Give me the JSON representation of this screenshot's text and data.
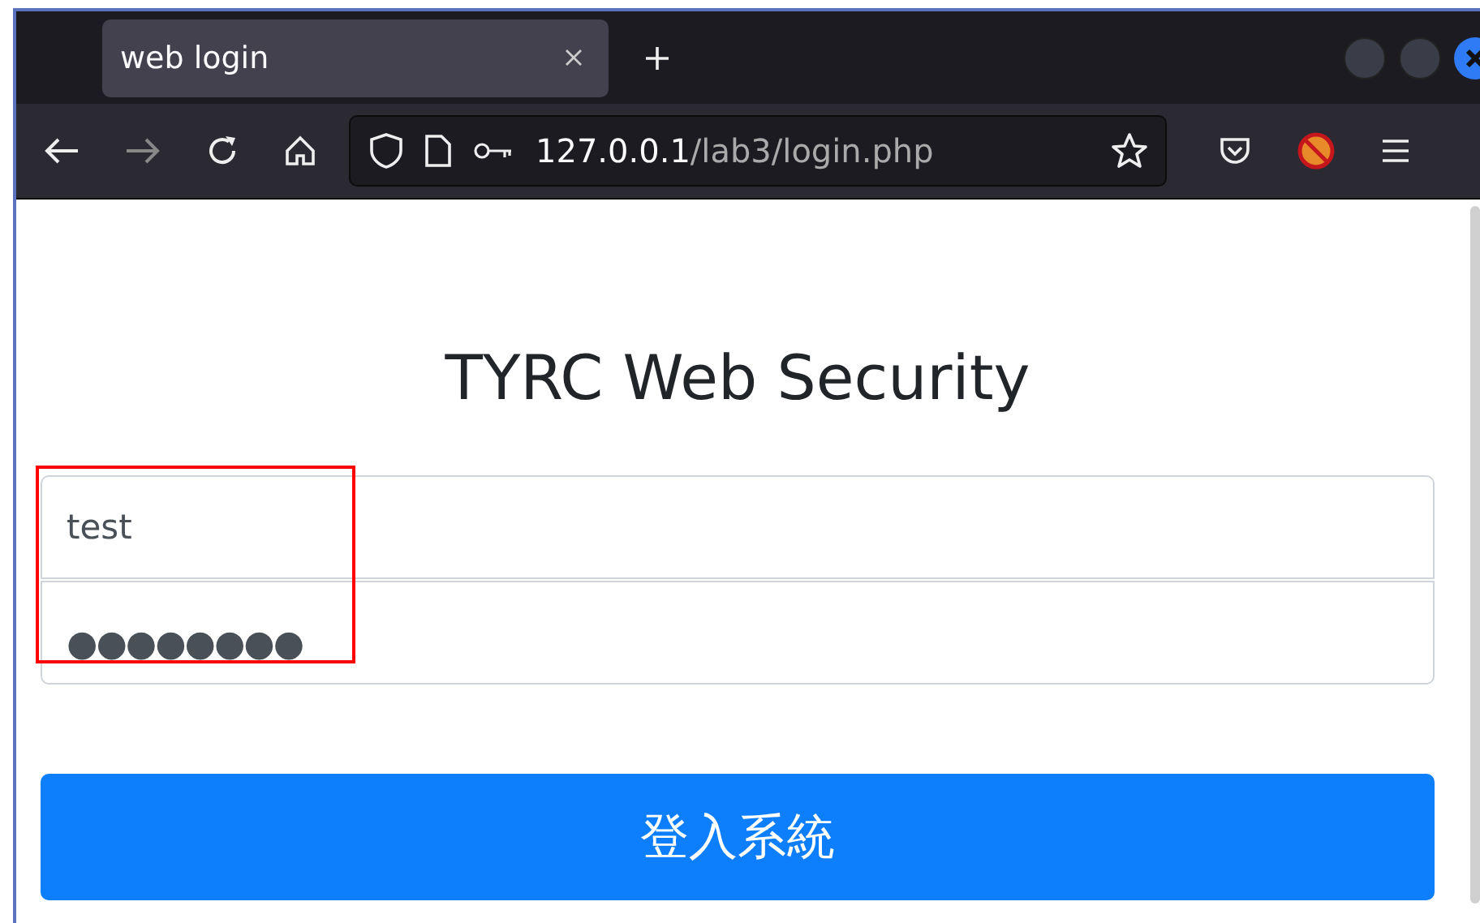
{
  "browser": {
    "tab": {
      "title": "web login",
      "selected": true
    },
    "url": {
      "host": "127.0.0.1",
      "path": "/lab3/login.php"
    }
  },
  "page": {
    "title": "TYRC Web Security",
    "username": {
      "value": "test"
    },
    "password": {
      "value": "●●●●●●●●"
    },
    "submit": "登入系統"
  }
}
